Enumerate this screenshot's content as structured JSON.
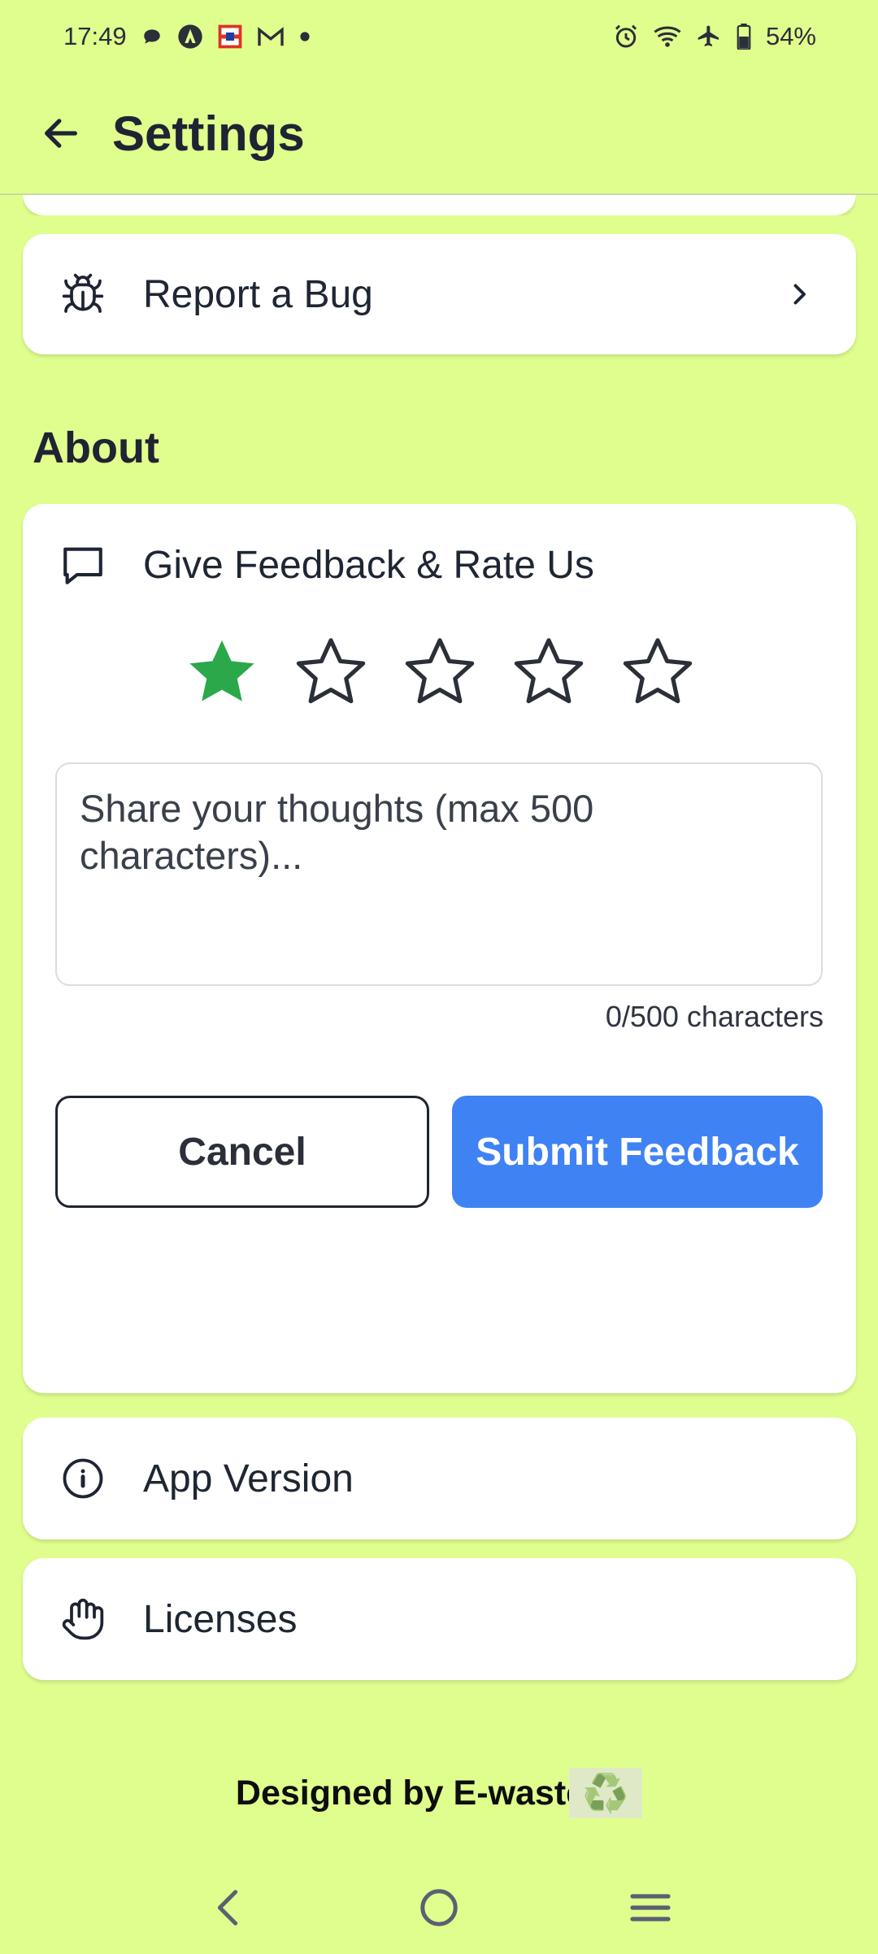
{
  "status_bar": {
    "time": "17:49",
    "battery": "54%",
    "left_icons": [
      "chat-bubble-icon",
      "android-auto-icon",
      "app-notification-icon",
      "gmail-icon",
      "dot-icon"
    ],
    "right_icons": [
      "alarm-icon",
      "wifi-icon",
      "airplane-icon",
      "battery-icon"
    ]
  },
  "app_bar": {
    "title": "Settings",
    "back_icon": "arrow-left-icon"
  },
  "rows": {
    "report_bug": {
      "label": "Report a Bug",
      "icon": "bug-icon",
      "chevron": "chevron-right-icon"
    },
    "feedback": {
      "label": "Give Feedback & Rate Us",
      "icon": "message-square-icon"
    },
    "app_version": {
      "label": "App Version",
      "icon": "info-icon"
    },
    "licenses": {
      "label": "Licenses",
      "icon": "hand-icon"
    }
  },
  "about_section": {
    "title": "About"
  },
  "feedback_form": {
    "rating": 1,
    "max_rating": 5,
    "selected_color": "#2aa84a",
    "placeholder": "Share your thoughts (max 500 characters)...",
    "value": "",
    "char_count": "0/500 characters",
    "cancel_label": "Cancel",
    "submit_label": "Submit Feedback",
    "submit_color": "#3f82f4"
  },
  "footer": {
    "text": "Designed by E-waste",
    "emoji": "♻️"
  },
  "nav_bar": {
    "icons": [
      "back-nav-icon",
      "home-nav-icon",
      "recents-nav-icon"
    ]
  },
  "colors": {
    "background": "#e0fe8e",
    "card": "#ffffff",
    "text": "#1e2433"
  }
}
